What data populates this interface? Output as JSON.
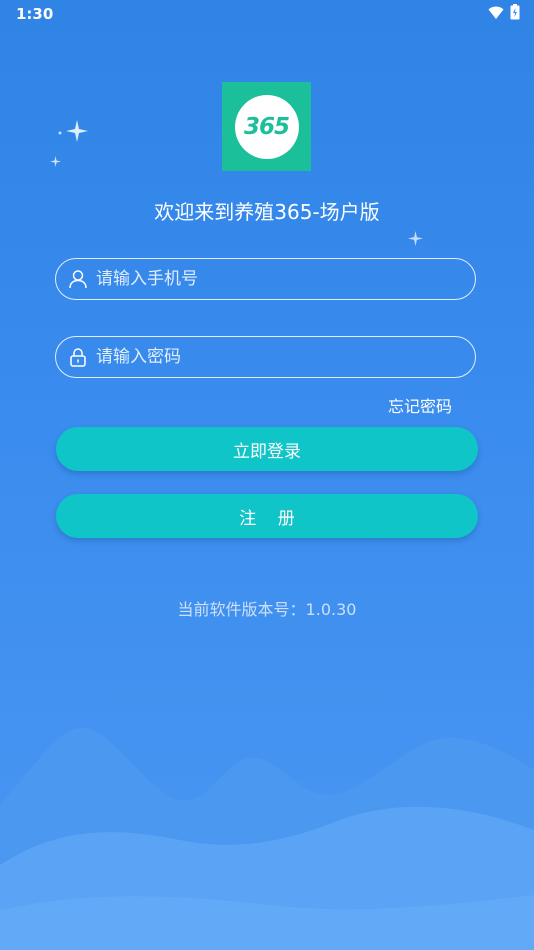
{
  "status_bar": {
    "time": "1:30",
    "icons": [
      "wifi-icon",
      "battery-icon"
    ]
  },
  "app": {
    "logo_text": "365",
    "welcome": "欢迎来到养殖365-场户版"
  },
  "form": {
    "phone_placeholder": "请输入手机号",
    "phone_value": "",
    "password_placeholder": "请输入密码",
    "password_value": "",
    "forgot_label": "忘记密码"
  },
  "buttons": {
    "login_label": "立即登录",
    "register_label": "注    册"
  },
  "footer": {
    "version_text": "当前软件版本号：1.0.30"
  },
  "colors": {
    "background": "#3a8cee",
    "button": "#0fc5c8",
    "logo": "#1bbf9a"
  }
}
